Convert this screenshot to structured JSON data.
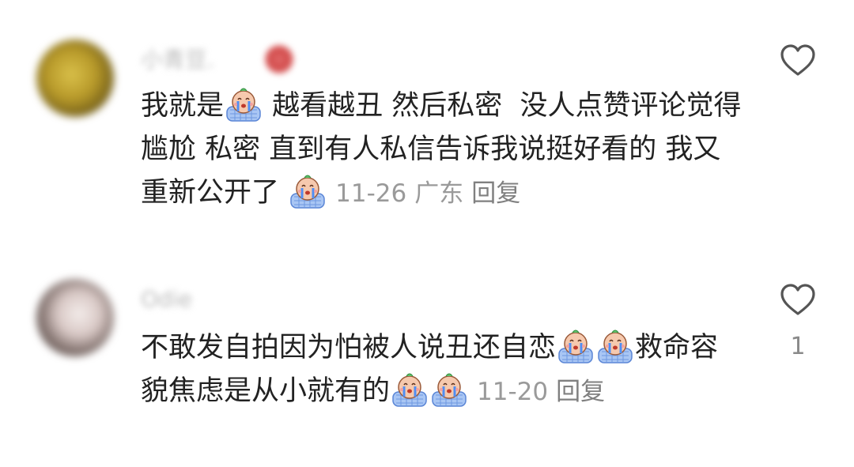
{
  "comments": [
    {
      "username": "小青豆.",
      "text_1": "我就是",
      "text_2": " 越看越丑 然后私密  没人点赞评论觉得尴尬 私密 直到有人私信告诉我说挺好看的 我又重新公开了 ",
      "date": "11-26",
      "location": "广东",
      "reply_label": "回复",
      "like_count": "",
      "icons": [
        "crying-baby-emoji",
        "heart-outline-icon"
      ]
    },
    {
      "username": "Odie",
      "text_1": "不敢发自拍因为怕被人说丑还自恋",
      "text_2": "救命容貌焦虑是从小就有的",
      "date": "11-20",
      "location": "",
      "reply_label": "回复",
      "like_count": "1",
      "icons": [
        "crying-baby-emoji",
        "heart-outline-icon"
      ]
    }
  ],
  "colors": {
    "text": "#222222",
    "meta": "#9a9a9a",
    "heart": "#555555"
  }
}
